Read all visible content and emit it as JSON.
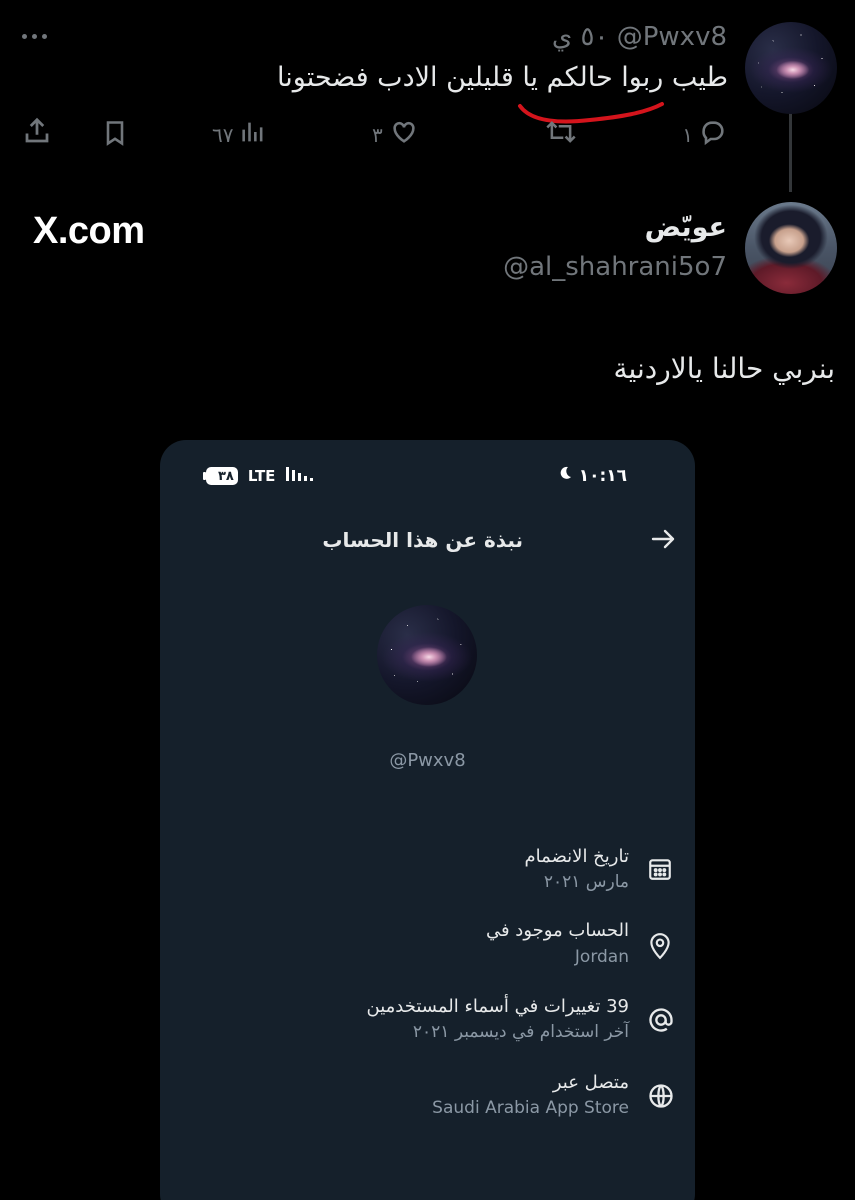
{
  "tweet1": {
    "handle": "@Pwxv8",
    "time": "٥٠ ي",
    "text": "طيب ربوا حالكم يا قليلين الادب فضحتونا",
    "actions": {
      "replies": "١",
      "likes": "٣",
      "views": "٦٧"
    }
  },
  "watermark": "X.com",
  "tweet2": {
    "display_name": "عويّض",
    "handle": "@al_shahrani5o7",
    "text": "بنربي حالنا يالاردنية"
  },
  "phone": {
    "status": {
      "time": "١٠:١٦",
      "network": "LTE",
      "battery": "٣٨"
    },
    "header_title": "نبذة عن هذا الحساب",
    "profile_handle": "@Pwxv8",
    "rows": [
      {
        "icon": "calendar-icon",
        "title": "تاريخ الانضمام",
        "subtitle": "مارس ٢٠٢١"
      },
      {
        "icon": "location-pin-icon",
        "title": "الحساب موجود في",
        "subtitle": "Jordan"
      },
      {
        "icon": "at-sign-icon",
        "title": "39 تغييرات في أسماء المستخدمين",
        "subtitle": "آخر استخدام في ديسمبر ٢٠٢١"
      },
      {
        "icon": "globe-icon",
        "title": "متصل عبر",
        "subtitle": "Saudi Arabia App Store"
      }
    ]
  },
  "colors": {
    "background": "#000000",
    "card": "#15202b",
    "muted": "#71767b",
    "text": "#e7e9ea",
    "annotation_red": "#d4141c"
  }
}
